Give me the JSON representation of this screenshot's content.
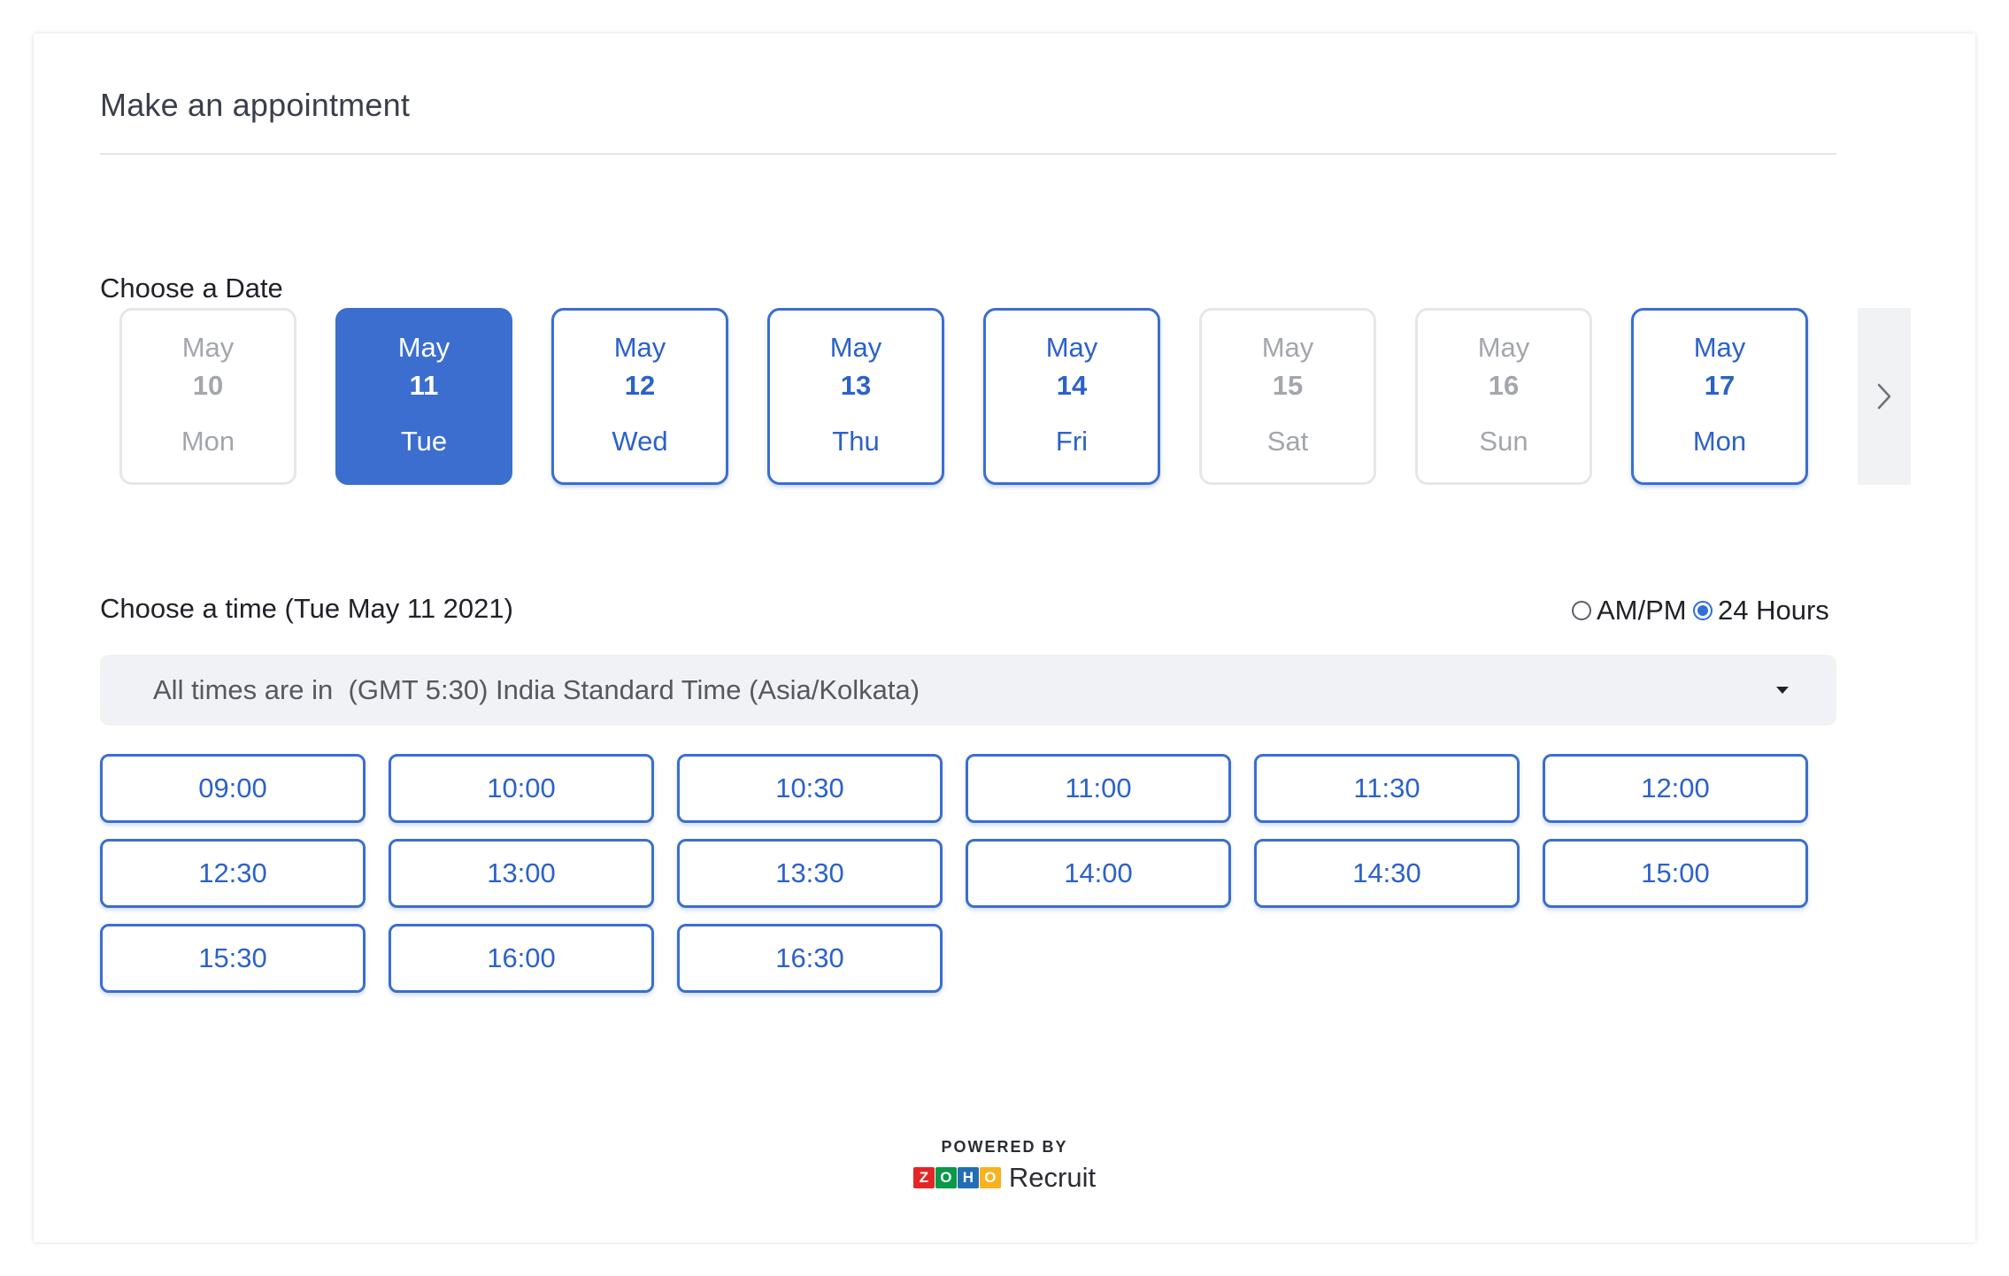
{
  "header": {
    "title": "Make an appointment"
  },
  "date_section": {
    "label": "Choose a Date",
    "dates": [
      {
        "month": "May",
        "day": "10",
        "weekday": "Mon",
        "state": "disabled"
      },
      {
        "month": "May",
        "day": "11",
        "weekday": "Tue",
        "state": "selected"
      },
      {
        "month": "May",
        "day": "12",
        "weekday": "Wed",
        "state": "available"
      },
      {
        "month": "May",
        "day": "13",
        "weekday": "Thu",
        "state": "available"
      },
      {
        "month": "May",
        "day": "14",
        "weekday": "Fri",
        "state": "available"
      },
      {
        "month": "May",
        "day": "15",
        "weekday": "Sat",
        "state": "disabled"
      },
      {
        "month": "May",
        "day": "16",
        "weekday": "Sun",
        "state": "disabled"
      },
      {
        "month": "May",
        "day": "17",
        "weekday": "Mon",
        "state": "available"
      }
    ],
    "next_icon": "chevron-right-icon"
  },
  "time_section": {
    "label": "Choose a time (Tue May 11 2021)",
    "format_options": [
      {
        "label": "AM/PM",
        "checked": false
      },
      {
        "label": "24 Hours",
        "checked": true
      }
    ],
    "timezone": {
      "text": "All times are in  (GMT 5:30) India Standard Time (Asia/Kolkata)",
      "caret_icon": "caret-down-icon"
    },
    "slots": [
      "09:00",
      "10:00",
      "10:30",
      "11:00",
      "11:30",
      "12:00",
      "12:30",
      "13:00",
      "13:30",
      "14:00",
      "14:30",
      "15:00",
      "15:30",
      "16:00",
      "16:30"
    ]
  },
  "footer": {
    "powered_by": "POWERED BY",
    "logo_letters": [
      "Z",
      "O",
      "H",
      "O"
    ],
    "brand_name": "Recruit"
  },
  "colors": {
    "accent": "#3b6ecf",
    "disabled_text": "#a3a6ad",
    "zoho_red": "#e42527",
    "zoho_green": "#089949",
    "zoho_blue": "#226db4",
    "zoho_yellow": "#f9b21d"
  }
}
